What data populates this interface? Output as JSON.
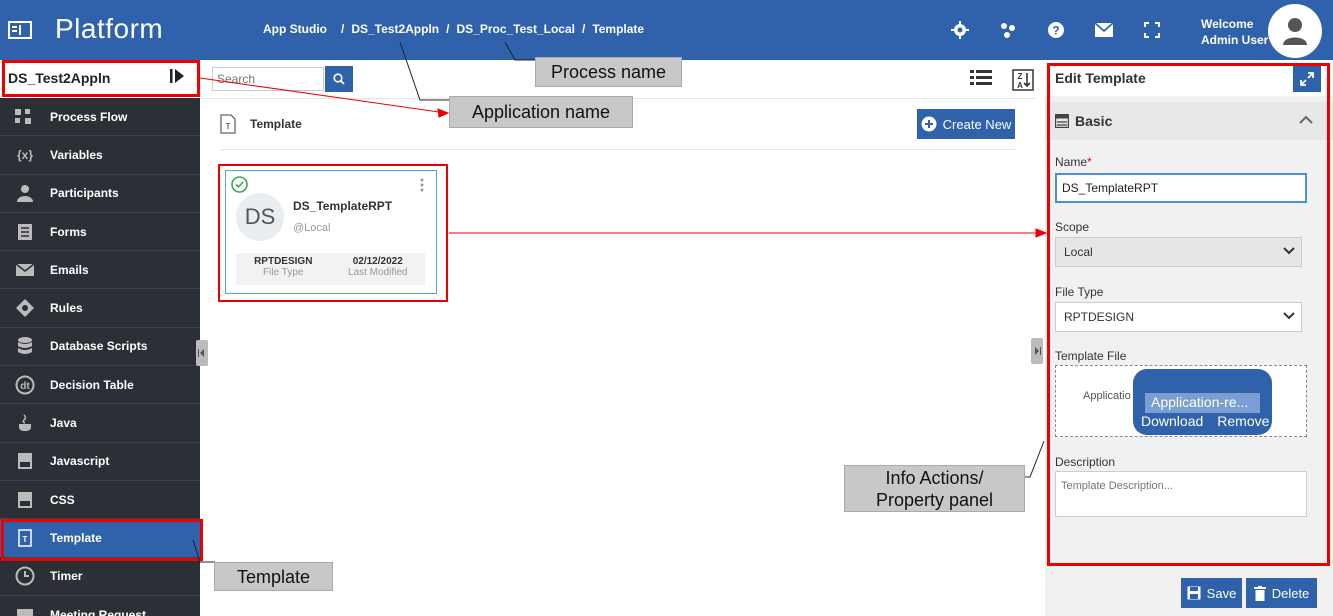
{
  "topbar": {
    "brand": "Platform",
    "breadcrumb": [
      "App Studio",
      "DS_Test2Appln",
      "DS_Proc_Test_Local",
      "Template"
    ],
    "separator": "/",
    "welcome_line1": "Welcome",
    "welcome_line2": "Admin User",
    "icons": [
      "gear-icon",
      "network-icon",
      "help-icon",
      "mail-icon",
      "fullscreen-icon"
    ]
  },
  "sidebar": {
    "app_name": "DS_Test2Appln",
    "items": [
      {
        "label": "Process Flow",
        "icon": "process-flow-icon"
      },
      {
        "label": "Variables",
        "icon": "variables-icon"
      },
      {
        "label": "Participants",
        "icon": "participants-icon"
      },
      {
        "label": "Forms",
        "icon": "forms-icon"
      },
      {
        "label": "Emails",
        "icon": "emails-icon"
      },
      {
        "label": "Rules",
        "icon": "rules-icon"
      },
      {
        "label": "Database Scripts",
        "icon": "database-icon"
      },
      {
        "label": "Decision Table",
        "icon": "decision-table-icon"
      },
      {
        "label": "Java",
        "icon": "java-icon"
      },
      {
        "label": "Javascript",
        "icon": "javascript-icon"
      },
      {
        "label": "CSS",
        "icon": "css-icon"
      },
      {
        "label": "Template",
        "icon": "template-icon",
        "active": true
      },
      {
        "label": "Timer",
        "icon": "timer-icon"
      },
      {
        "label": "Meeting Request",
        "icon": "meeting-icon"
      }
    ]
  },
  "main": {
    "search_placeholder": "Search",
    "section_title": "Template",
    "create_label": "Create New",
    "card": {
      "initials": "DS",
      "name": "DS_TemplateRPT",
      "scope": "@Local",
      "file_type_value": "RPTDESIGN",
      "file_type_label": "File Type",
      "modified_value": "02/12/2022",
      "modified_label": "Last Modified"
    }
  },
  "panel": {
    "title": "Edit Template",
    "section": "Basic",
    "name_label": "Name",
    "required_mark": "*",
    "name_value": "DS_TemplateRPT",
    "scope_label": "Scope",
    "scope_value": "Local",
    "file_type_label": "File Type",
    "file_type_value": "RPTDESIGN",
    "template_file_label": "Template File",
    "file_text": "Applicatio",
    "file_name": "Application-re...",
    "download_label": "Download",
    "remove_label": "Remove",
    "description_label": "Description",
    "description_placeholder": "Template Description...",
    "save_label": "Save",
    "delete_label": "Delete"
  },
  "annotations": {
    "process_name": "Process name",
    "application_name": "Application name",
    "template": "Template",
    "info_line1": "Info Actions/",
    "info_line2": "Property panel"
  },
  "colors": {
    "brand_blue": "#2f62ab",
    "sidebar_bg": "#2b2f36",
    "annotation_red": "#e00000",
    "success_green": "#3aa657"
  }
}
